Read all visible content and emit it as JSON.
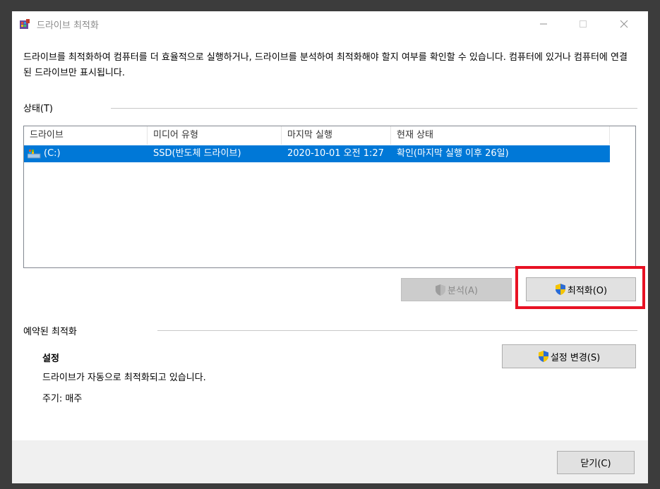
{
  "window": {
    "title": "드라이브 최적화",
    "controls": {
      "minimize": "─",
      "maximize": "☐",
      "close": "✕"
    }
  },
  "description": "드라이브를 최적화하여 컴퓨터를 더 효율적으로 실행하거나, 드라이브를 분석하여 최적화해야 할지 여부를 확인할 수 있습니다. 컴퓨터에 있거나 컴퓨터에 연결된 드라이브만 표시됩니다.",
  "status_section": {
    "label": "상태(T)",
    "columns": [
      "드라이브",
      "미디어 유형",
      "마지막 실행",
      "현재 상태"
    ],
    "rows": [
      {
        "drive": "(C:)",
        "media_type": "SSD(반도체 드라이브)",
        "last_run": "2020-10-01 오전 1:27",
        "current_status": "확인(마지막 실행 이후 26일)",
        "selected": true
      }
    ]
  },
  "buttons": {
    "analyze": "분석(A)",
    "optimize": "최적화(O)",
    "change_settings": "설정 변경(S)",
    "close": "닫기(C)"
  },
  "scheduled_section": {
    "label": "예약된 최적화",
    "settings_title": "설정",
    "settings_text": "드라이브가 자동으로 최적화되고 있습니다.",
    "frequency": "주기: 매주"
  },
  "colors": {
    "selection": "#0078d7",
    "highlight_box": "#e81123"
  },
  "icons": {
    "app": "defrag-app-icon",
    "drive": "drive-icon",
    "uac": "uac-shield-icon"
  }
}
